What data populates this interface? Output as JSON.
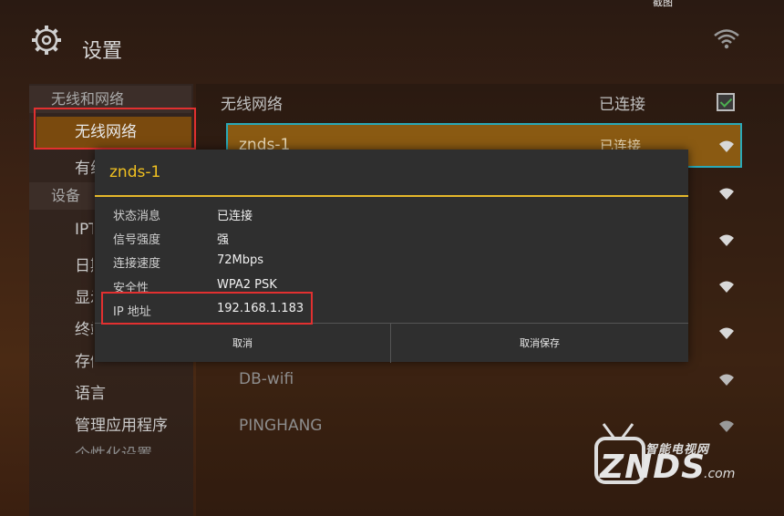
{
  "screenshot_label": "截图",
  "header": {
    "title": "设置"
  },
  "sidebar": {
    "category_network": "无线和网络",
    "item_wireless": "无线网络",
    "item_wired": "有线网络",
    "category_device": "设备",
    "items": [
      "IPTV",
      "日期和时间",
      "显示",
      "终端信息",
      "存储",
      "语言",
      "管理应用程序",
      "个性化设置"
    ]
  },
  "wireless": {
    "header_label": "无线网络",
    "header_status": "已连接",
    "checked": true,
    "networks": [
      {
        "name": "znds-1",
        "status": "已连接"
      },
      {
        "name": "DB-wifi",
        "status": ""
      },
      {
        "name": "PINGHANG",
        "status": ""
      }
    ]
  },
  "dialog": {
    "title": "znds-1",
    "rows": [
      {
        "label": "状态消息",
        "value": "已连接"
      },
      {
        "label": "信号强度",
        "value": "强"
      },
      {
        "label": "连接速度",
        "value": "72Mbps"
      },
      {
        "label": "安全性",
        "value": "WPA2 PSK"
      },
      {
        "label": "IP 地址",
        "value": "192.168.1.183"
      }
    ],
    "buttons": {
      "cancel": "取消",
      "forget": "取消保存"
    }
  },
  "watermark": {
    "tagline": "智能电视网",
    "brand": "ZNDS",
    "suffix": ".com"
  },
  "colors": {
    "accent": "#f0c020",
    "selection": "#7a4a0e",
    "highlight_border": "#e23030"
  }
}
